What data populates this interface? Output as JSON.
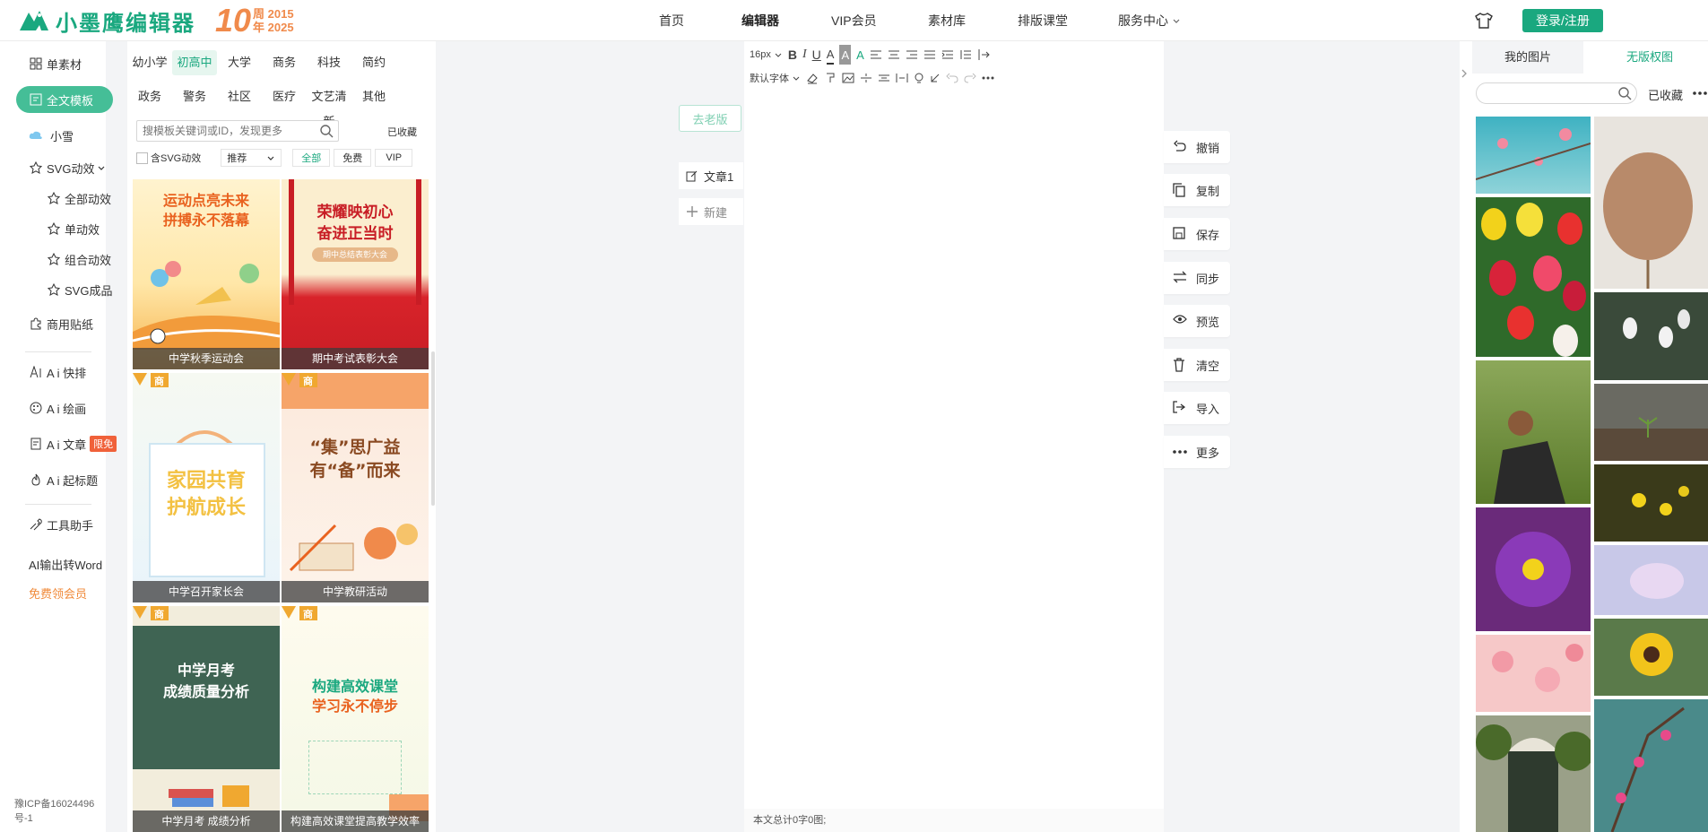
{
  "header": {
    "logo_text": "小墨鹰编辑器",
    "anniversary_num": "10",
    "anniversary_line1": "周 2015",
    "anniversary_line2": "年 2025",
    "nav": [
      {
        "label": "首页",
        "active": false
      },
      {
        "label": "编辑器",
        "active": true
      },
      {
        "label": "VIP会员",
        "active": false
      },
      {
        "label": "素材库",
        "active": false
      },
      {
        "label": "排版课堂",
        "active": false
      },
      {
        "label": "服务中心",
        "active": false
      }
    ],
    "login_label": "登录/注册",
    "brand_color": "#1aa87f",
    "accent_color": "#f08a4b"
  },
  "sidebar": {
    "items": [
      {
        "label": "单素材",
        "icon": "grid-icon"
      },
      {
        "label": "全文模板",
        "icon": "document-icon",
        "active": true
      },
      {
        "label": "小雪",
        "icon": "cloud-icon"
      },
      {
        "label": "SVG动效",
        "icon": "star-outline-icon"
      },
      {
        "label": "全部动效",
        "icon": "star-outline-icon"
      },
      {
        "label": "单动效",
        "icon": "star-outline-icon"
      },
      {
        "label": "组合动效",
        "icon": "star-outline-icon"
      },
      {
        "label": "SVG成品",
        "icon": "star-outline-icon"
      },
      {
        "label": "商用贴纸",
        "icon": "puzzle-icon"
      },
      {
        "label": "A i 快排",
        "icon": "ai-icon"
      },
      {
        "label": "A i 绘画",
        "icon": "palette-icon"
      },
      {
        "label": "A i 文章",
        "icon": "article-icon"
      },
      {
        "label": "A i 起标题",
        "icon": "fire-icon"
      },
      {
        "label": "工具助手",
        "icon": "tools-icon"
      },
      {
        "label": "AI输出转Word"
      },
      {
        "label": "免费领会员"
      }
    ],
    "free_tag": "限免",
    "icp": "豫ICP备16024496号-1"
  },
  "templates": {
    "categories_row1": [
      "幼小学",
      "初高中",
      "大学",
      "商务",
      "科技",
      "简约"
    ],
    "categories_row2": [
      "政务",
      "警务",
      "社区",
      "医疗",
      "文艺清新",
      "其他"
    ],
    "active_category": "初高中",
    "search_placeholder": "搜模板关键词或ID，发现更多",
    "favorites": "已收藏",
    "svg_filter": "含SVG动效",
    "sort": "推荐",
    "filter_tabs": [
      "全部",
      "免费",
      "VIP"
    ],
    "cards": [
      {
        "caption": "中学秋季运动会",
        "art1": "运动点亮未来",
        "art2": "拼搏永不落幕"
      },
      {
        "caption": "期中考试表彰大会",
        "art1": "荣耀映初心",
        "art2": "奋进正当时",
        "art3": "期中总结表彰大会"
      },
      {
        "caption": "中学召开家长会",
        "art1": "家园共育",
        "art2": "护航成长",
        "badge": "商"
      },
      {
        "caption": "中学教研活动",
        "art1": "“集”思广益",
        "art2": "有“备”而来",
        "badge": "商"
      },
      {
        "caption": "中学月考 成绩分析",
        "art1": "中学月考",
        "art2": "成绩质量分析",
        "badge": "商"
      },
      {
        "caption": "构建高效课堂提高教学效率",
        "art1": "构建高效课堂",
        "art2": "学习永不停步",
        "badge": "商"
      }
    ]
  },
  "articles": {
    "old_version": "去老版",
    "items": [
      "文章1",
      "新建"
    ]
  },
  "editor": {
    "font_size": "16px",
    "font_family": "默认字体",
    "word_count": "本文总计0字0图;"
  },
  "actions": [
    "撤销",
    "复制",
    "保存",
    "同步",
    "预览",
    "清空",
    "导入",
    "更多"
  ],
  "images_panel": {
    "tabs": [
      "我的图片",
      "无版权图"
    ],
    "favorites": "已收藏",
    "search_prefix": "©"
  }
}
